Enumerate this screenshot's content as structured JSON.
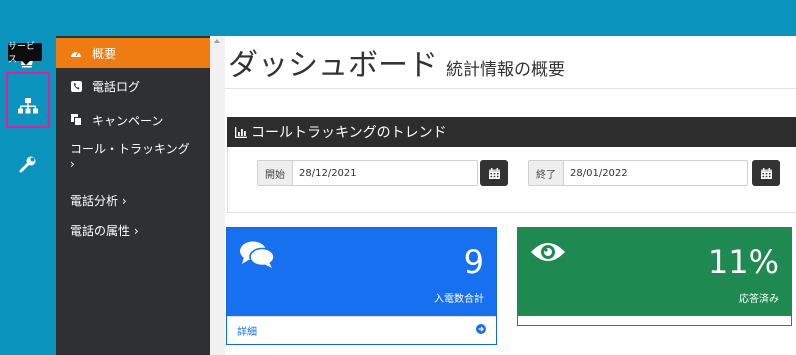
{
  "rail": {
    "tooltip": "サービス"
  },
  "sidebar": {
    "items": [
      {
        "label": "概要",
        "icon": "dashboard-icon"
      },
      {
        "label": "電話ログ",
        "icon": "phone-icon"
      },
      {
        "label": "キャンペーン",
        "icon": "copy-icon"
      },
      {
        "label": "コール・トラッキング",
        "suffix": "›"
      },
      {
        "label": "電話分析 ›"
      },
      {
        "label": "電話の属性 ›"
      }
    ]
  },
  "page": {
    "title": "ダッシュボード",
    "subtitle": "統計情報の概要"
  },
  "trend": {
    "header": "コールトラッキングのトレンド",
    "start_label": "開始",
    "start_value": "28/12/2021",
    "end_label": "終了",
    "end_value": "28/01/2022"
  },
  "cards": {
    "calls": {
      "value": "9",
      "label": "入電数合計",
      "footer": "詳細",
      "color": "#1670f0"
    },
    "answered": {
      "value": "11%",
      "label": "応答済み",
      "color": "#1e8a52"
    }
  },
  "colors": {
    "topbar": "#0a94bd",
    "sidebar": "#2f3033",
    "active": "#ee7c13",
    "highlight": "#e0219a"
  }
}
